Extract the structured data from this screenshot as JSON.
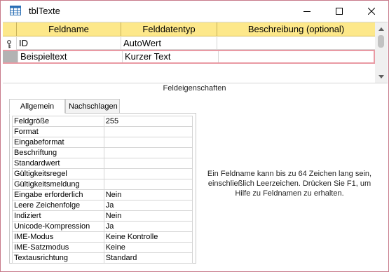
{
  "window": {
    "title": "tblTexte",
    "icon": "table-icon",
    "border_color": "#c77a8a"
  },
  "grid": {
    "header_color": "#fde88a",
    "columns": [
      "Feldname",
      "Felddatentyp",
      "Beschreibung (optional)"
    ],
    "rows": [
      {
        "name": "ID",
        "type": "AutoWert",
        "description": "",
        "primary_key": true,
        "selected": false
      },
      {
        "name": "Beispieltext",
        "type": "Kurzer Text",
        "description": "",
        "primary_key": false,
        "selected": true
      }
    ]
  },
  "properties": {
    "section_title": "Feldeigenschaften",
    "tabs": [
      {
        "label": "Allgemein",
        "active": true
      },
      {
        "label": "Nachschlagen",
        "active": false
      }
    ],
    "items": [
      {
        "label": "Feldgröße",
        "value": "255"
      },
      {
        "label": "Format",
        "value": ""
      },
      {
        "label": "Eingabeformat",
        "value": ""
      },
      {
        "label": "Beschriftung",
        "value": ""
      },
      {
        "label": "Standardwert",
        "value": ""
      },
      {
        "label": "Gültigkeitsregel",
        "value": ""
      },
      {
        "label": "Gültigkeitsmeldung",
        "value": ""
      },
      {
        "label": "Eingabe erforderlich",
        "value": "Nein"
      },
      {
        "label": "Leere Zeichenfolge",
        "value": "Ja"
      },
      {
        "label": "Indiziert",
        "value": "Nein"
      },
      {
        "label": "Unicode-Kompression",
        "value": "Ja"
      },
      {
        "label": "IME-Modus",
        "value": "Keine Kontrolle"
      },
      {
        "label": "IME-Satzmodus",
        "value": "Keine"
      },
      {
        "label": "Textausrichtung",
        "value": "Standard"
      }
    ],
    "help_text": "Ein Feldname kann bis zu 64 Zeichen lang sein, einschließlich Leerzeichen. Drücken Sie F1, um Hilfe zu Feldnamen zu erhalten."
  }
}
